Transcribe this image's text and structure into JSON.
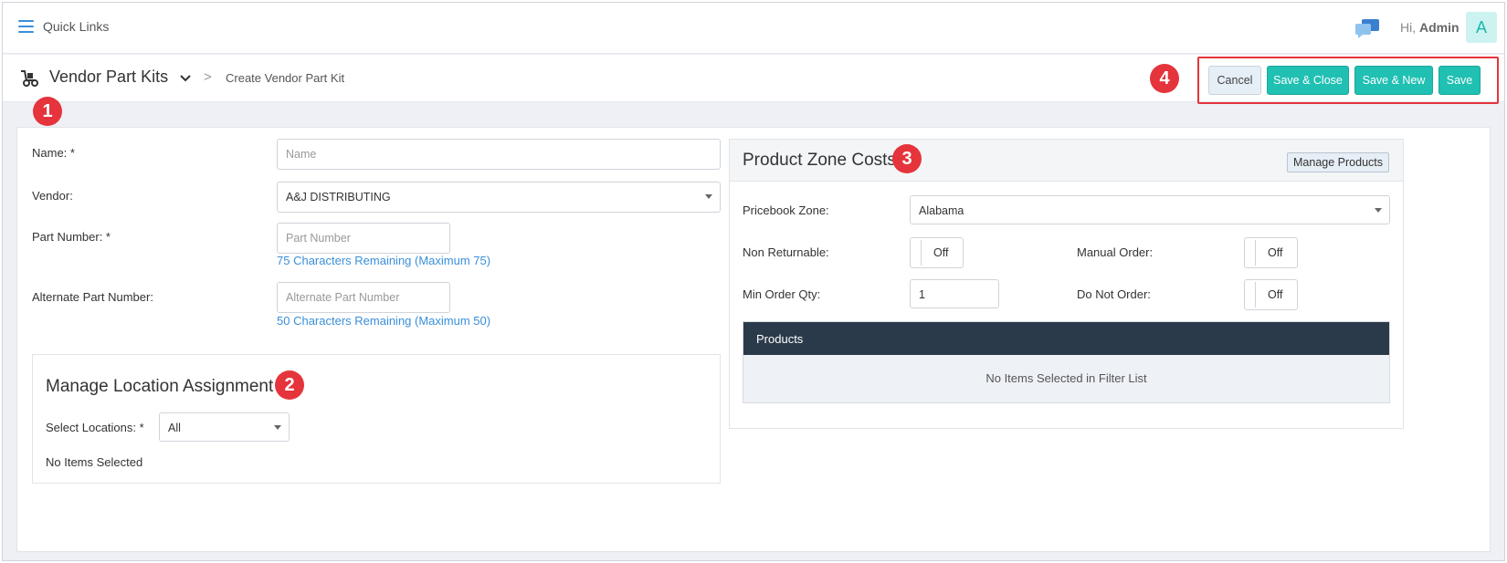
{
  "topbar": {
    "quick_links_label": "Quick Links",
    "greeting_prefix": "Hi,",
    "user_name": "Admin",
    "avatar_letter": "A"
  },
  "header": {
    "module_title": "Vendor Part Kits",
    "breadcrumb_sep": ">",
    "breadcrumb_current": "Create Vendor Part Kit",
    "actions": {
      "cancel": "Cancel",
      "save_close": "Save & Close",
      "save_new": "Save & New",
      "save": "Save"
    }
  },
  "badges": {
    "b1": "1",
    "b2": "2",
    "b3": "3",
    "b4": "4"
  },
  "form": {
    "name_label": "Name: *",
    "name_placeholder": "Name",
    "vendor_label": "Vendor:",
    "vendor_value": "A&J DISTRIBUTING",
    "part_number_label": "Part Number: *",
    "part_number_placeholder": "Part Number",
    "part_number_hint": "75 Characters Remaining (Maximum 75)",
    "alt_part_label": "Alternate Part Number:",
    "alt_part_placeholder": "Alternate Part Number",
    "alt_part_hint": "50 Characters Remaining (Maximum 50)"
  },
  "location": {
    "title": "Manage Location Assignment",
    "select_label": "Select Locations: *",
    "select_value": "All",
    "empty_text": "No Items Selected"
  },
  "zone": {
    "title": "Product Zone Costs",
    "manage_button": "Manage Products",
    "pricebook_label": "Pricebook Zone:",
    "pricebook_value": "Alabama",
    "non_returnable_label": "Non Returnable:",
    "non_returnable_value": "Off",
    "manual_order_label": "Manual Order:",
    "manual_order_value": "Off",
    "min_qty_label": "Min Order Qty:",
    "min_qty_value": "1",
    "do_not_order_label": "Do Not Order:",
    "do_not_order_value": "Off",
    "products_header": "Products",
    "products_empty": "No Items Selected in Filter List"
  },
  "colors": {
    "accent": "#20c0b3",
    "badge": "#e5343b",
    "link": "#3a8fd9",
    "products_header_bg": "#2b3a4a"
  },
  "icons": {
    "menu": "hamburger-icon",
    "chat": "chat-icon",
    "module": "hand-truck-icon",
    "dropdown": "chevron-down-icon"
  }
}
